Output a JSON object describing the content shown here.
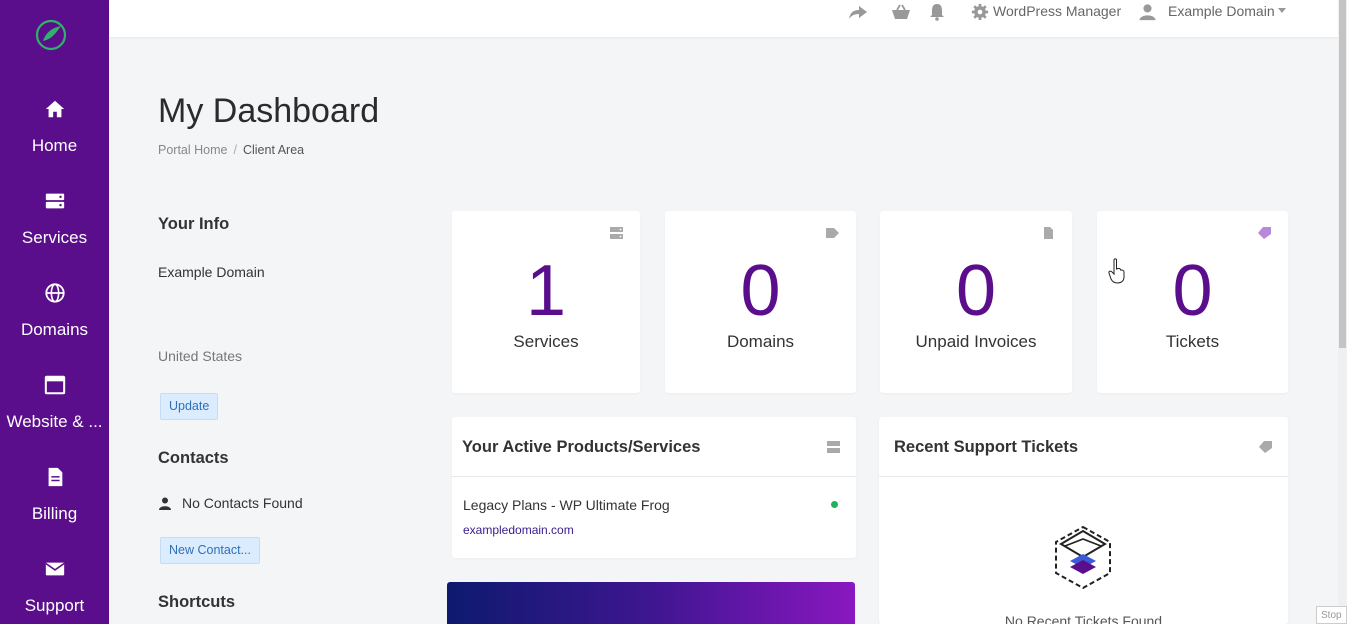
{
  "sidebar": {
    "items": [
      {
        "label": "Home",
        "icon": "home-icon"
      },
      {
        "label": "Services",
        "icon": "server-icon"
      },
      {
        "label": "Domains",
        "icon": "globe-icon"
      },
      {
        "label": "Website & ...",
        "icon": "window-icon"
      },
      {
        "label": "Billing",
        "icon": "document-icon"
      },
      {
        "label": "Support",
        "icon": "envelope-icon"
      }
    ],
    "logo": "brand-logo-icon"
  },
  "topbar": {
    "wp_manager": "WordPress Manager",
    "account": "Example Domain"
  },
  "page": {
    "title": "My Dashboard",
    "breadcrumb": [
      "Portal Home",
      "Client Area"
    ]
  },
  "info": {
    "heading": "Your Info",
    "name": "Example Domain",
    "country": "United States",
    "update_label": "Update"
  },
  "contacts": {
    "heading": "Contacts",
    "empty": "No Contacts Found",
    "new_label": "New Contact..."
  },
  "shortcuts": {
    "heading": "Shortcuts"
  },
  "stats": [
    {
      "value": "1",
      "label": "Services",
      "icon": "server-icon"
    },
    {
      "value": "0",
      "label": "Domains",
      "icon": "tag-icon"
    },
    {
      "value": "0",
      "label": "Unpaid Invoices",
      "icon": "file-icon"
    },
    {
      "value": "0",
      "label": "Tickets",
      "icon": "ticket-icon"
    }
  ],
  "products_panel": {
    "title": "Your Active Products/Services",
    "item_name": "Legacy Plans - WP Ultimate Frog",
    "item_domain": "exampledomain.com",
    "status_color": "#27ae60"
  },
  "tickets_panel": {
    "title": "Recent Support Tickets",
    "empty": "No Recent Tickets Found"
  },
  "colors": {
    "sidebar": "#5b0e8b",
    "accent_number": "#5b0e8b",
    "link": "#3b1a8a"
  },
  "misc": {
    "stop_label": "Stop"
  }
}
